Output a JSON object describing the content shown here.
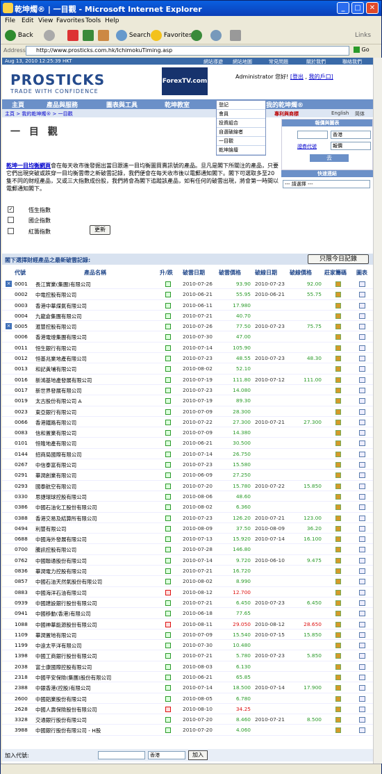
{
  "window": {
    "title": "乾坤燭® | 一目觀 - Microsoft Internet Explorer"
  },
  "menu": [
    "File",
    "Edit",
    "View",
    "Favorites",
    "Tools",
    "Help"
  ],
  "toolbar": {
    "back": "Back",
    "search": "Search",
    "favorites": "Favorites",
    "links": "Links"
  },
  "address": {
    "label": "Address",
    "url": "http://www.prosticks.com.hk/IchimokuTiming.asp",
    "go": "Go"
  },
  "topbar": {
    "date": "Aug 13, 2010 12:25:39 HKT",
    "links": [
      "網站導遊",
      "網站地圖",
      "常見問題",
      "關於我們",
      "聯絡我們"
    ]
  },
  "header": {
    "logo": "PROSTICKS",
    "tagline": "TRADE WITH CONFIDENCE",
    "forex": "ForexTV.com",
    "admin": "Administrator 您好!",
    "logout": "[登出",
    "myportal": "我的戶口]"
  },
  "nav": [
    "主頁",
    "產品與服務",
    "圖表與工具",
    "乾坤教室",
    "我的乾坤燭®"
  ],
  "dropdown": [
    "登記",
    "會員",
    "投資組合",
    "自選破線者",
    "一目觀",
    "乾坤論壇"
  ],
  "nav_right": {
    "premium": "專利與商標",
    "english": "English",
    "simp": "简体"
  },
  "crumb": "主頁 > 我的乾坤燭® > 一目觀",
  "page_title": "一 目 觀",
  "quote_panel": {
    "title": "報價與圖表",
    "market": "香港",
    "code_label": "證券代號",
    "type": "報價",
    "go": "去"
  },
  "quicklinks": {
    "title": "快速連結",
    "placeholder": "--- 請選擇 ---"
  },
  "intro": {
    "link": "乾坤一目均衡網頁",
    "text": "會在每天收市後發掘出當日跟進一目均衡圖買賣訊號的產品。旦凡是閣下所關注的產品，只要它們出現突破或跌穿一目均衡雲帶之新破雲記錄，我們便會在每天收市後以電郵通知閣下。閣下可選取多至20隻不同的財經產品，又或三大指數成份股，我們將會為閣下追蹤該產品，如有任何的破雲出現，將會第一時間以電郵通知閣下。"
  },
  "checks": [
    {
      "label": "恆生指數",
      "checked": true
    },
    {
      "label": "國企指數",
      "checked": false
    },
    {
      "label": "紅籌指數",
      "checked": false
    }
  ],
  "update_btn": "更新",
  "list": {
    "title": "閣下選擇財經產品之最新破雲記錄:",
    "today_btn": "只限今日記錄"
  },
  "columns": [
    "代號",
    "產品名稱",
    "升/跌",
    "破雲日期",
    "破雲價格",
    "破線日期",
    "破線價格",
    "莊家籌碼",
    "圖表"
  ],
  "rows": [
    {
      "code": "0001",
      "name": "長江實業(集團)有限公司",
      "date": "2010-07-26",
      "price": "93.90",
      "cdate": "2010-07-23",
      "cprice": "92.00",
      "x": true
    },
    {
      "code": "0002",
      "name": "中電控股有限公司",
      "date": "2010-06-21",
      "price": "55.95",
      "cdate": "2010-06-21",
      "cprice": "55.75"
    },
    {
      "code": "0003",
      "name": "香港中華煤氣有限公司",
      "date": "2010-06-11",
      "price": "17.980",
      "cdate": "",
      "cprice": ""
    },
    {
      "code": "0004",
      "name": "九龍倉集團有限公司",
      "date": "2010-07-21",
      "price": "40.70",
      "cdate": "",
      "cprice": ""
    },
    {
      "code": "0005",
      "name": "滙豐控股有限公司",
      "date": "2010-07-26",
      "price": "77.50",
      "cdate": "2010-07-23",
      "cprice": "75.75",
      "x": true
    },
    {
      "code": "0006",
      "name": "香港電燈集團有限公司",
      "date": "2010-07-30",
      "price": "47.00",
      "cdate": "",
      "cprice": ""
    },
    {
      "code": "0011",
      "name": "恒生銀行有限公司",
      "date": "2010-07-14",
      "price": "105.90",
      "cdate": "",
      "cprice": ""
    },
    {
      "code": "0012",
      "name": "恒基兆業地產有限公司",
      "date": "2010-07-23",
      "price": "48.55",
      "cdate": "2010-07-23",
      "cprice": "48.30"
    },
    {
      "code": "0013",
      "name": "和記黃埔有限公司",
      "date": "2010-08-02",
      "price": "52.10",
      "cdate": "",
      "cprice": ""
    },
    {
      "code": "0016",
      "name": "新鴻基地產發展有限公司",
      "date": "2010-07-19",
      "price": "111.80",
      "cdate": "2010-07-12",
      "cprice": "111.00"
    },
    {
      "code": "0017",
      "name": "新世界發展有限公司",
      "date": "2010-07-23",
      "price": "14.080",
      "cdate": "",
      "cprice": ""
    },
    {
      "code": "0019",
      "name": "太古股份有限公司 A",
      "date": "2010-07-19",
      "price": "89.30",
      "cdate": "",
      "cprice": ""
    },
    {
      "code": "0023",
      "name": "東亞銀行有限公司",
      "date": "2010-07-09",
      "price": "28.300",
      "cdate": "",
      "cprice": ""
    },
    {
      "code": "0066",
      "name": "香港鐵路有限公司",
      "date": "2010-07-22",
      "price": "27.300",
      "cdate": "2010-07-21",
      "cprice": "27.300"
    },
    {
      "code": "0083",
      "name": "信和置業有限公司",
      "date": "2010-07-09",
      "price": "14.380",
      "cdate": "",
      "cprice": ""
    },
    {
      "code": "0101",
      "name": "恒隆地產有限公司",
      "date": "2010-06-21",
      "price": "30.500",
      "cdate": "",
      "cprice": ""
    },
    {
      "code": "0144",
      "name": "招商局國際有限公司",
      "date": "2010-07-14",
      "price": "26.750",
      "cdate": "",
      "cprice": ""
    },
    {
      "code": "0267",
      "name": "中信泰富有限公司",
      "date": "2010-07-23",
      "price": "15.580",
      "cdate": "",
      "cprice": ""
    },
    {
      "code": "0291",
      "name": "華潤創業有限公司",
      "date": "2010-06-09",
      "price": "27.250",
      "cdate": "",
      "cprice": ""
    },
    {
      "code": "0293",
      "name": "國泰航空有限公司",
      "date": "2010-07-20",
      "price": "15.780",
      "cdate": "2010-07-22",
      "cprice": "15.850"
    },
    {
      "code": "0330",
      "name": "思捷環球控股有限公司",
      "date": "2010-08-06",
      "price": "48.60",
      "cdate": "",
      "cprice": ""
    },
    {
      "code": "0386",
      "name": "中國石油化工股份有限公司",
      "date": "2010-08-02",
      "price": "6.360",
      "cdate": "",
      "cprice": ""
    },
    {
      "code": "0388",
      "name": "香港交易及結算所有限公司",
      "date": "2010-07-23",
      "price": "126.20",
      "cdate": "2010-07-21",
      "cprice": "123.00"
    },
    {
      "code": "0494",
      "name": "利豐有限公司",
      "date": "2010-08-09",
      "price": "37.50",
      "cdate": "2010-08-09",
      "cprice": "36.20"
    },
    {
      "code": "0688",
      "name": "中國海外發展有限公司",
      "date": "2010-07-13",
      "price": "15.920",
      "cdate": "2010-07-14",
      "cprice": "16.100"
    },
    {
      "code": "0700",
      "name": "騰訊控股有限公司",
      "date": "2010-07-28",
      "price": "146.80",
      "cdate": "",
      "cprice": ""
    },
    {
      "code": "0762",
      "name": "中國聯通股份有限公司",
      "date": "2010-07-14",
      "price": "9.720",
      "cdate": "2010-06-10",
      "cprice": "9.475"
    },
    {
      "code": "0836",
      "name": "華潤電力控股有限公司",
      "date": "2010-07-21",
      "price": "16.720",
      "cdate": "",
      "cprice": ""
    },
    {
      "code": "0857",
      "name": "中國石油天然氣股份有限公司",
      "date": "2010-08-02",
      "price": "8.990",
      "cdate": "",
      "cprice": ""
    },
    {
      "code": "0883",
      "name": "中國海洋石油有限公司",
      "date": "2010-08-12",
      "price": "12.700",
      "cdate": "",
      "cprice": "",
      "down": true
    },
    {
      "code": "0939",
      "name": "中國建設銀行股份有限公司",
      "date": "2010-07-21",
      "price": "6.450",
      "cdate": "2010-07-23",
      "cprice": "6.450"
    },
    {
      "code": "0941",
      "name": "中國移動(香港)有限公司",
      "date": "2010-06-18",
      "price": "77.65",
      "cdate": "",
      "cprice": ""
    },
    {
      "code": "1088",
      "name": "中國神華能源股份有限公司",
      "date": "2010-08-11",
      "price": "29.050",
      "cdate": "2010-08-12",
      "cprice": "28.650",
      "down": true
    },
    {
      "code": "1109",
      "name": "華潤置地有限公司",
      "date": "2010-07-09",
      "price": "15.540",
      "cdate": "2010-07-15",
      "cprice": "15.850"
    },
    {
      "code": "1199",
      "name": "中遠太平洋有限公司",
      "date": "2010-07-30",
      "price": "10.480",
      "cdate": "",
      "cprice": ""
    },
    {
      "code": "1398",
      "name": "中國工商銀行股份有限公司",
      "date": "2010-07-21",
      "price": "5.780",
      "cdate": "2010-07-23",
      "cprice": "5.850"
    },
    {
      "code": "2038",
      "name": "富士康國際控股有限公司",
      "date": "2010-08-03",
      "price": "6.130",
      "cdate": "",
      "cprice": ""
    },
    {
      "code": "2318",
      "name": "中國平安保險(集團)股份有限公司",
      "date": "2010-06-21",
      "price": "65.85",
      "cdate": "",
      "cprice": ""
    },
    {
      "code": "2388",
      "name": "中銀香港(控股)有限公司",
      "date": "2010-07-14",
      "price": "18.500",
      "cdate": "2010-07-14",
      "cprice": "17.900"
    },
    {
      "code": "2600",
      "name": "中國鋁業股份有限公司",
      "date": "2010-08-05",
      "price": "6.780",
      "cdate": "",
      "cprice": ""
    },
    {
      "code": "2628",
      "name": "中國人壽保險股份有限公司",
      "date": "2010-08-10",
      "price": "34.25",
      "cdate": "",
      "cprice": "",
      "down": true
    },
    {
      "code": "3328",
      "name": "交通銀行股份有限公司",
      "date": "2010-07-20",
      "price": "8.460",
      "cdate": "2010-07-21",
      "cprice": "8.500"
    },
    {
      "code": "3988",
      "name": "中國銀行股份有限公司 - H股",
      "date": "2010-07-20",
      "price": "4.060",
      "cdate": "",
      "cprice": ""
    }
  ],
  "footer": {
    "label": "加入代號:",
    "market": "香港",
    "add": "加入"
  },
  "status": "",
  "colors": {
    "up": "#2a9a2a",
    "down": "#d11",
    "brand": "#244a8c",
    "nav": "#6b90c8"
  }
}
